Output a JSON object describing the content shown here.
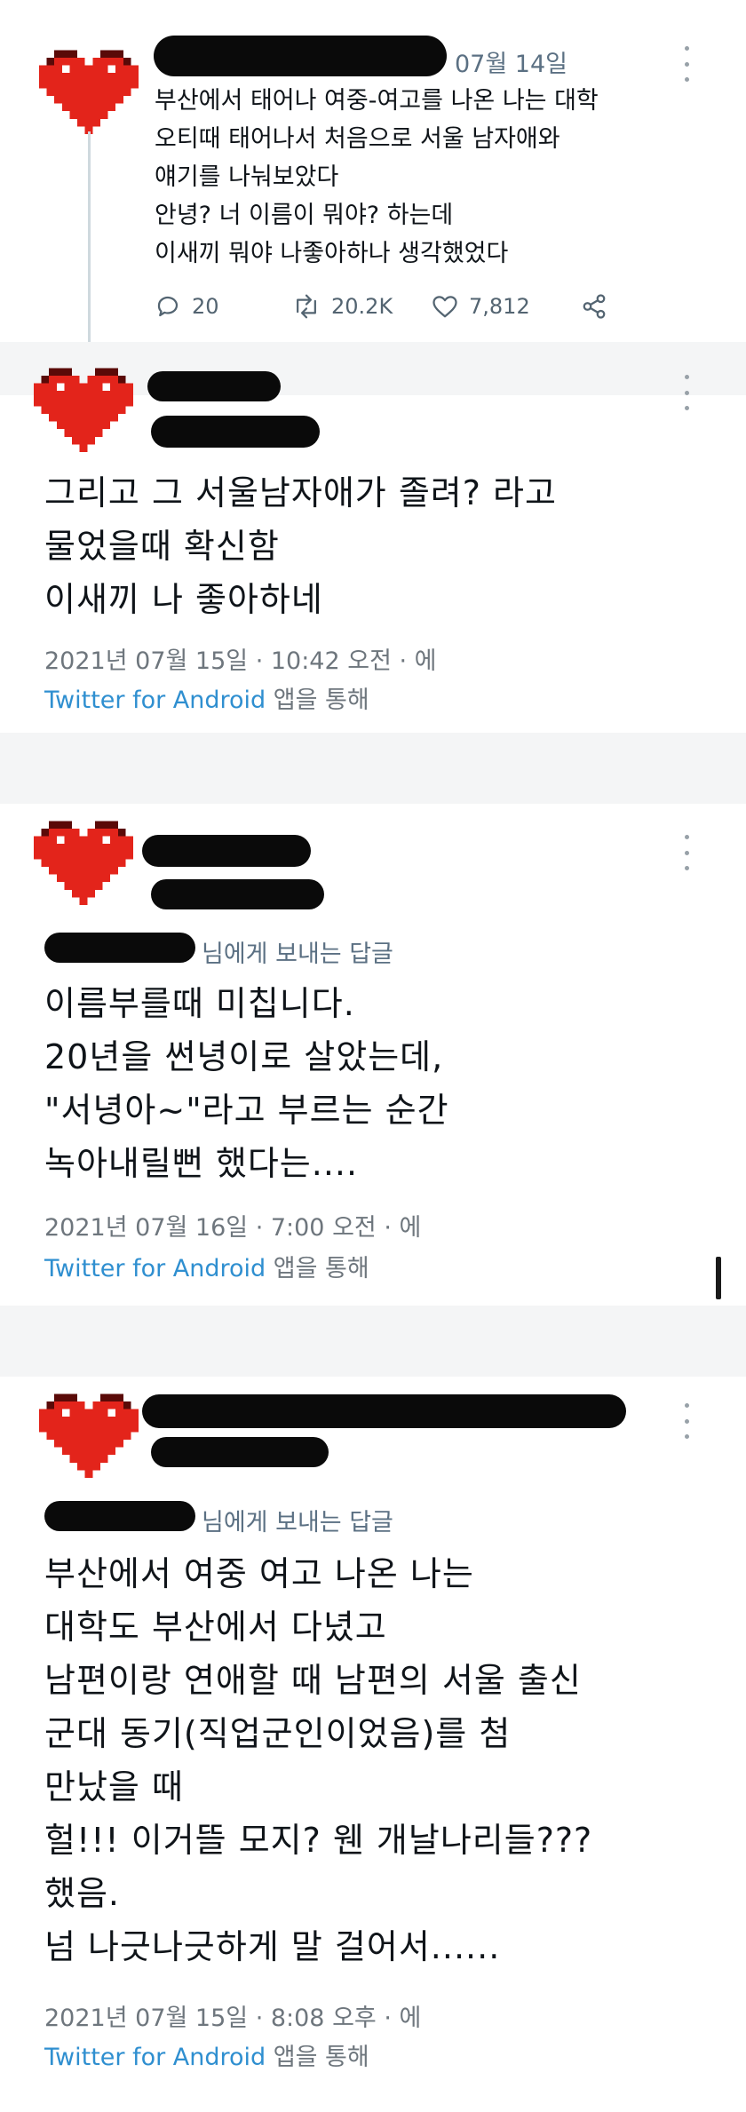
{
  "colors": {
    "heart": "#e3241b",
    "link": "#2f8fd0",
    "meta": "#6e767d"
  },
  "tweet1": {
    "date": "07월 14일",
    "lines": [
      "부산에서 태어나 여중-여고를 나온 나는 대학",
      "오티때 태어나서 처음으로 서울 남자애와",
      "얘기를 나눠보았다",
      "안녕? 너 이름이 뭐야? 하는데",
      "이새끼 뭐야 나좋아하나 생각했었다"
    ],
    "replies": "20",
    "retweets": "20.2K",
    "likes": "7,812",
    "icons": [
      "reply-icon",
      "retweet-icon",
      "like-icon",
      "share-icon"
    ]
  },
  "tweet2": {
    "lines": [
      "그리고 그 서울남자애가 졸려? 라고",
      "물었을때 확신함",
      "이새끼 나 좋아하네"
    ],
    "timestamp": "2021년 07월 15일 · 10:42 오전 · 에",
    "source_app": "Twitter for Android",
    "source_suffix": "앱을 통해"
  },
  "tweet3": {
    "replying_to": "님에게 보내는 답글",
    "lines": [
      "이름부를때 미칩니다.",
      "20년을 썬녕이로 살았는데,",
      "\"서녕아~\"라고 부르는 순간",
      "녹아내릴뻔 했다는...."
    ],
    "timestamp": "2021년 07월 16일 · 7:00 오전 · 에",
    "source_app": "Twitter for Android",
    "source_suffix": "앱을 통해"
  },
  "tweet4": {
    "replying_to": "님에게 보내는 답글",
    "lines": [
      "부산에서 여중 여고 나온 나는",
      "대학도 부산에서 다녔고",
      "남편이랑 연애할 때 남편의 서울 출신",
      "군대 동기(직업군인이었음)를 첨",
      "만났을 때",
      "헐!!! 이거뜰 모지? 웬 개날나리들???",
      "했음.",
      "넘 나긋나긋하게 말 걸어서......"
    ],
    "timestamp": "2021년 07월 15일 · 8:08 오후 · 에",
    "source_app": "Twitter for Android",
    "source_suffix": "앱을 통해"
  }
}
